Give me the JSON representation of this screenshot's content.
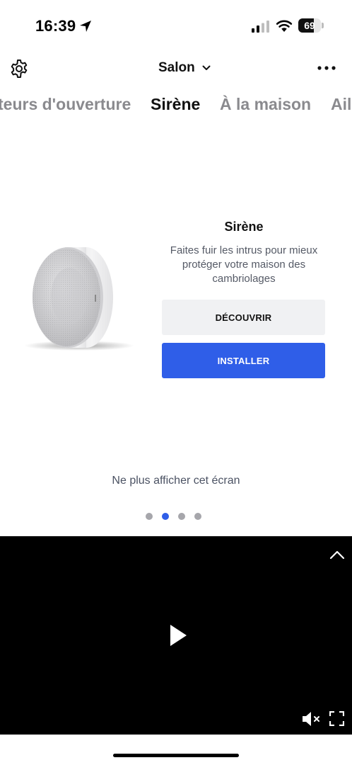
{
  "status_bar": {
    "time": "16:39",
    "battery_level": 69,
    "battery_label": "69",
    "icons": [
      "location-arrow-icon",
      "cellular-signal-icon",
      "wifi-icon",
      "battery-icon"
    ]
  },
  "header": {
    "room": "Salon",
    "icons": [
      "gear-icon",
      "chevron-down-icon",
      "more-icon"
    ]
  },
  "tabs": [
    {
      "label": "Détecteurs d'ouverture",
      "visible_text": "teurs d'ouverture",
      "active": false
    },
    {
      "label": "Sirène",
      "active": true
    },
    {
      "label": "À la maison",
      "active": false
    },
    {
      "label": "Ail",
      "active": false
    }
  ],
  "card": {
    "title": "Sirène",
    "description": "Faites fuir les intrus pour mieux protéger votre maison des cambriolages",
    "discover_label": "DÉCOUVRIR",
    "install_label": "INSTALLER"
  },
  "dismiss_label": "Ne plus afficher cet écran",
  "pagination": {
    "total": 4,
    "active_index": 1
  },
  "video": {
    "icons": [
      "collapse-icon",
      "play-icon",
      "mute-icon",
      "fullscreen-icon"
    ]
  },
  "colors": {
    "accent": "#2f5ee8",
    "secondary_button": "#f0f1f3",
    "inactive_tab": "#8a8a8e",
    "video_background": "#000000"
  }
}
